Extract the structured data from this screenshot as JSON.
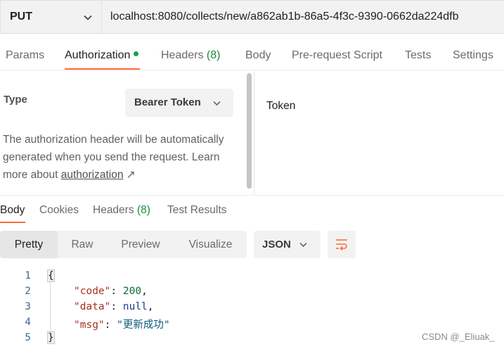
{
  "request": {
    "method": "PUT",
    "url": "localhost:8080/collects/new/a862ab1b-86a5-4f3c-9390-0662da224dfb"
  },
  "request_tabs": [
    {
      "label": "Params"
    },
    {
      "label": "Authorization"
    },
    {
      "label": "Headers ",
      "count": "(8)"
    },
    {
      "label": "Body"
    },
    {
      "label": "Pre-request Script"
    },
    {
      "label": "Tests"
    },
    {
      "label": "Settings"
    }
  ],
  "auth": {
    "type_label": "Type",
    "type_value": "Bearer Token",
    "desc_prefix": "The authorization header will be automatically generated when you send the request. Learn more about ",
    "desc_link": "authorization",
    "desc_arrow": "↗",
    "token_label": "Token"
  },
  "response_tabs": [
    {
      "label": "Body"
    },
    {
      "label": "Cookies"
    },
    {
      "label": "Headers ",
      "count": "(8)"
    },
    {
      "label": "Test Results"
    }
  ],
  "view_modes": [
    "Pretty",
    "Raw",
    "Preview",
    "Visualize"
  ],
  "format": "JSON",
  "code": {
    "line_numbers": [
      "1",
      "2",
      "3",
      "4",
      "5"
    ],
    "open_brace": "{",
    "close_brace": "}",
    "fields": [
      {
        "key": "\"code\"",
        "value": "200",
        "kind": "number"
      },
      {
        "key": "\"data\"",
        "value": "null",
        "kind": "null"
      },
      {
        "key": "\"msg\"",
        "value": "\"更新成功\"",
        "kind": "string"
      }
    ]
  },
  "watermark": "CSDN @_Eliuak_",
  "colors": {
    "accent": "#ff6c37",
    "status_dot": "#16a34a"
  },
  "icons": {
    "method_dropdown": "chevron-down-icon",
    "type_dropdown": "chevron-down-icon",
    "format_dropdown": "chevron-down-icon",
    "wrap": "wrap-lines-icon"
  }
}
